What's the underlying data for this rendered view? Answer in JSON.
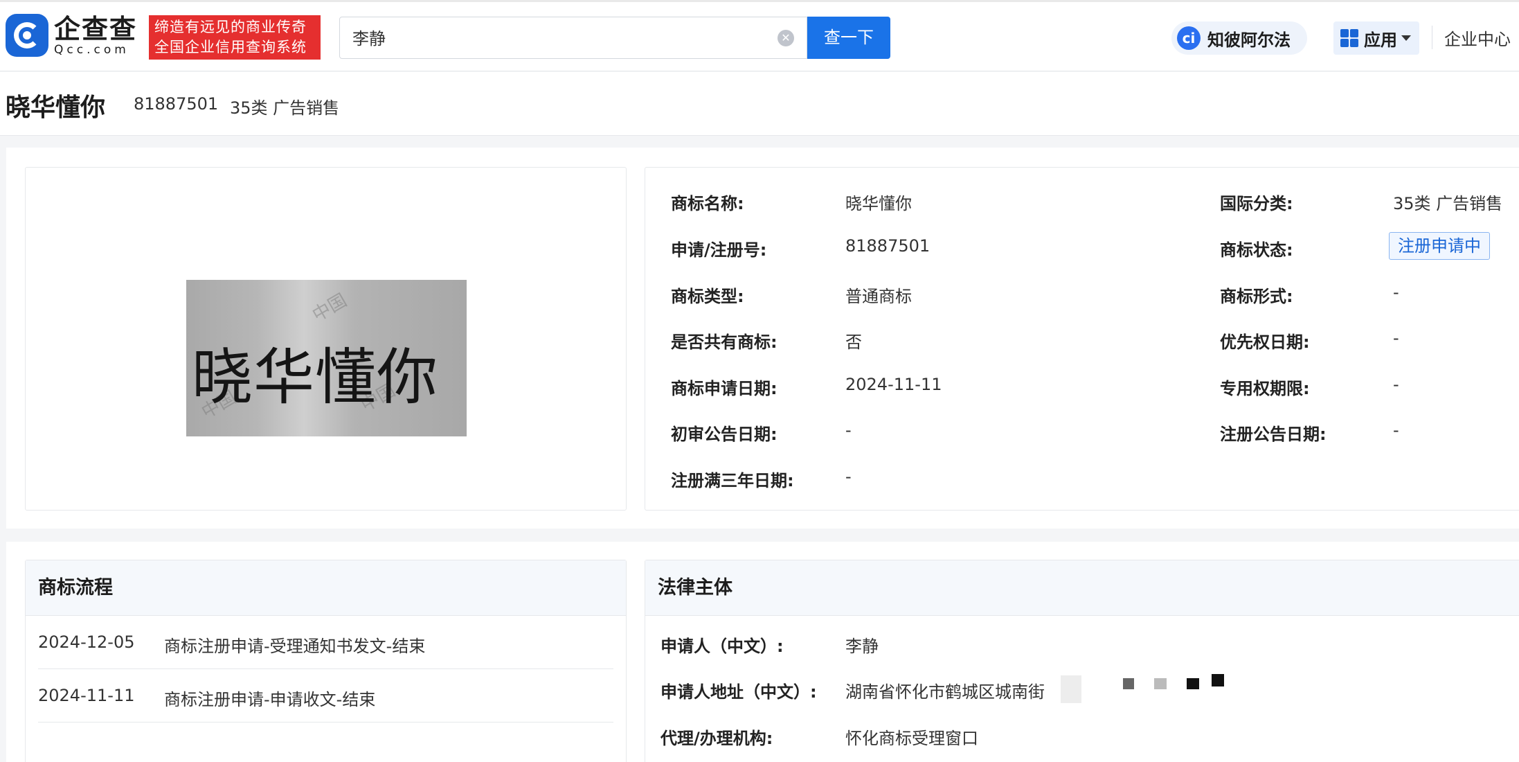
{
  "header": {
    "logo_cn": "企查查",
    "logo_en": "Qcc.com",
    "slogan_line1": "缔造有远见的商业传奇",
    "slogan_line2": "全国企业信用查询系统",
    "search_value": "李静",
    "search_button": "查一下",
    "ai_icon_letter": "ci",
    "ai_label": "知彼阿尔法",
    "app_label": "应用",
    "enterprise_center": "企业中心"
  },
  "title": {
    "name": "晓华懂你",
    "reg_no": "81887501",
    "class": "35类 广告销售"
  },
  "trademark": {
    "image_text": "晓华懂你",
    "watermark": "中国"
  },
  "info": {
    "name_label": "商标名称:",
    "name_value": "晓华懂你",
    "intl_class_label": "国际分类:",
    "intl_class_value": "35类 广告销售",
    "reg_no_label": "申请/注册号:",
    "reg_no_value": "81887501",
    "status_label": "商标状态:",
    "status_value": "注册申请中",
    "type_label": "商标类型:",
    "type_value": "普通商标",
    "form_label": "商标形式:",
    "form_value": "-",
    "shared_label": "是否共有商标:",
    "shared_value": "否",
    "priority_label": "优先权日期:",
    "priority_value": "-",
    "apply_date_label": "商标申请日期:",
    "apply_date_value": "2024-11-11",
    "exclusive_label": "专用权期限:",
    "exclusive_value": "-",
    "prelim_label": "初审公告日期:",
    "prelim_value": "-",
    "reg_announce_label": "注册公告日期:",
    "reg_announce_value": "-",
    "three_year_label": "注册满三年日期:",
    "three_year_value": "-"
  },
  "flow": {
    "title": "商标流程",
    "rows": [
      {
        "date": "2024-12-05",
        "desc": "商标注册申请-受理通知书发文-结束"
      },
      {
        "date": "2024-11-11",
        "desc": "商标注册申请-申请收文-结束"
      }
    ]
  },
  "legal": {
    "title": "法律主体",
    "applicant_label": "申请人（中文）:",
    "applicant_value": "李静",
    "address_label": "申请人地址（中文）:",
    "address_value": "湖南省怀化市鹤城区城南街",
    "agency_label": "代理/办理机构:",
    "agency_value": "怀化商标受理窗口"
  },
  "colors": {
    "brand_blue": "#1a73e8",
    "slogan_red": "#e52f2f"
  }
}
